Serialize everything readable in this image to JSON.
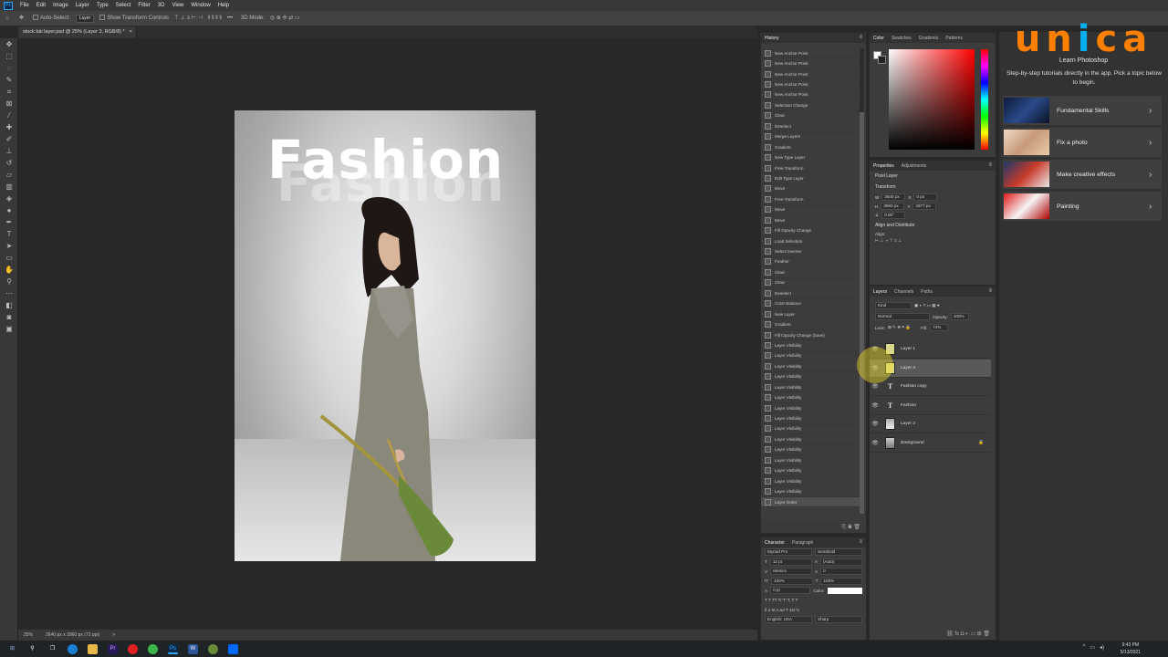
{
  "menu": [
    "File",
    "Edit",
    "Image",
    "Layer",
    "Type",
    "Select",
    "Filter",
    "3D",
    "View",
    "Window",
    "Help"
  ],
  "app_logo": "Ps",
  "options": {
    "auto_select": "Auto-Select:",
    "layer_select": "Layer",
    "transform_controls": "Show Transform Controls",
    "mode_3d": "3D Mode:",
    "more": "•••"
  },
  "doc_tab": {
    "title": "stock bài layer.psd @ 25% (Layer 3, RGB/8) *",
    "close": "×"
  },
  "canvas": {
    "text_main": "Fashion",
    "text_copy": "Fashion"
  },
  "status": {
    "zoom": "25%",
    "size": "2640 px x 3960 px (72 ppi)",
    "arrow": ">"
  },
  "history": {
    "tab": "History",
    "items": [
      "New Anchor Point",
      "New Anchor Point",
      "New Anchor Point",
      "New Anchor Point",
      "New Anchor Point",
      "Selection Change",
      "Clear",
      "Deselect",
      "Merge Layers",
      "Gradient",
      "New Type Layer",
      "Free Transform",
      "Edit Type Layer",
      "Move",
      "Free Transform",
      "Move",
      "Move",
      "Fill Opacity Change",
      "Load Selection",
      "Select Inverse",
      "Feather",
      "Clear",
      "Clear",
      "Deselect",
      "Color Balance",
      "New Layer",
      "Gradient",
      "Fill Opacity Change (Save)",
      "Layer Visibility",
      "Layer Visibility",
      "Layer Visibility",
      "Layer Visibility",
      "Layer Visibility",
      "Layer Visibility",
      "Layer Visibility",
      "Layer Visibility",
      "Layer Visibility",
      "Layer Visibility",
      "Layer Visibility",
      "Layer Visibility",
      "Layer Visibility",
      "Layer Visibility",
      "Layer Visibility",
      "Layer Order"
    ]
  },
  "character": {
    "tabs": [
      "Character",
      "Paragraph"
    ],
    "font": "Myriad Pro",
    "style": "Semibold",
    "size": "12 pt",
    "leading": "(Auto)",
    "kerning": "Metrics",
    "tracking": "0",
    "vscale": "100%",
    "hscale": "100%",
    "baseline": "0 pt",
    "color_label": "Color:",
    "glyphs": "T T TT Tr T' T, T T",
    "glyphs2": "fi ơ st A ad T 1st ½",
    "language": "English: USA",
    "aa": "Sharp"
  },
  "color_panel": {
    "tabs": [
      "Color",
      "Swatches",
      "Gradients",
      "Patterns"
    ]
  },
  "properties": {
    "tabs": [
      "Properties",
      "Adjustments"
    ],
    "kind": "Pixel Layer",
    "transform": "Transform",
    "w_label": "W",
    "w": "2640 px",
    "x_label": "X",
    "x": "0 px",
    "h_label": "H",
    "h": "3983 px",
    "y_label": "Y",
    "y": "2877 px",
    "angle": "0.00°",
    "align": "Align and Distribute",
    "align_label": "Align:"
  },
  "layers": {
    "tabs": [
      "Layers",
      "Channels",
      "Paths"
    ],
    "filter": "Kind",
    "blend": "Normal",
    "opacity_label": "Opacity:",
    "opacity": "100%",
    "lock_label": "Lock:",
    "fill_label": "Fill:",
    "fill": "74%",
    "rows": [
      {
        "name": "Layer 1",
        "type": "pixel"
      },
      {
        "name": "Layer 3",
        "type": "pixel"
      },
      {
        "name": "Fashion copy",
        "type": "text"
      },
      {
        "name": "Fashion",
        "type": "text"
      },
      {
        "name": "Layer 2",
        "type": "pixel"
      },
      {
        "name": "Background",
        "type": "pixel"
      }
    ]
  },
  "learn": {
    "brand": "unica",
    "title": "Learn Photoshop",
    "desc": "Step-by-step tutorials directly in the app. Pick a topic below to begin.",
    "cards": [
      "Fundamental Skills",
      "Fix a photo",
      "Make creative effects",
      "Painting"
    ]
  },
  "taskbar": {
    "time": "9:43 PM",
    "date": "5/13/2021"
  },
  "colors": {
    "accent": "#31a8ff",
    "brand_orange": "#ff7f00",
    "brand_blue": "#00aeef"
  }
}
